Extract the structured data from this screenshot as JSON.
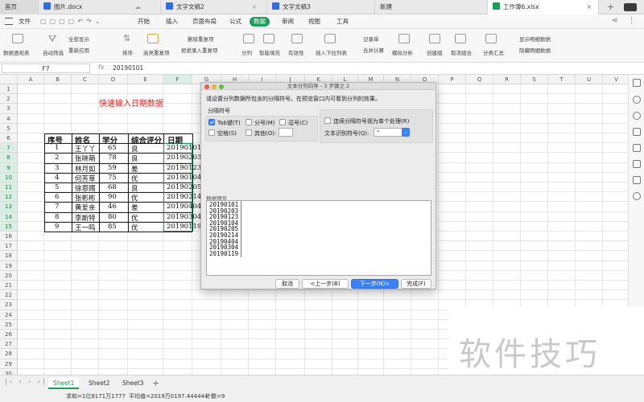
{
  "tabs": [
    {
      "label": "首页",
      "active": false
    },
    {
      "label": "图片.docx",
      "active": false
    },
    {
      "label": "文字文稿2",
      "active": false
    },
    {
      "label": "文字文稿3",
      "active": false
    },
    {
      "label": "新建",
      "active": false
    },
    {
      "label": "工作簿6.xlsx",
      "active": true
    }
  ],
  "menus": [
    "文件",
    "开始",
    "插入",
    "页面布局",
    "公式",
    "数据",
    "审阅",
    "视图",
    "工具"
  ],
  "active_menu": "数据",
  "ribbon": {
    "pivot": "数据透视表",
    "autofilter": "自动筛选",
    "showall": "全部显示",
    "reapply": "重新应用",
    "sort": "排序",
    "highlight_dup": "高亮重复项",
    "remove_dup": "删除重复项",
    "reject_dup": "拒绝录入重复项",
    "split": "分列",
    "smartfill": "智能填充",
    "validity": "有效性",
    "dropdown": "插入下拉列表",
    "record": "记录单",
    "consolidate": "合并计算",
    "whatif": "模拟分析",
    "group": "创建组",
    "ungroup": "取消组合",
    "subtotal": "分类汇总",
    "show_detail": "显示明细数据",
    "hide_detail": "隐藏明细数据"
  },
  "namebox": "F7",
  "formula_value": "20190101",
  "columns": [
    "A",
    "B",
    "C",
    "D",
    "E",
    "F",
    "G",
    "H",
    "I",
    "J",
    "K",
    "L",
    "M",
    "N",
    "O",
    "P",
    "Q",
    "R",
    "S",
    "T",
    "U",
    "V"
  ],
  "rows": [
    "1",
    "2",
    "3",
    "4",
    "5",
    "6",
    "7",
    "8",
    "9",
    "10",
    "11",
    "12",
    "13",
    "14",
    "15",
    "16",
    "17",
    "18",
    "19",
    "20",
    "21",
    "22",
    "23",
    "24",
    "25",
    "26",
    "27",
    "28",
    "29",
    "30"
  ],
  "sheet_title": "快速输入日期数据",
  "table_headers": [
    "序号",
    "姓名",
    "学分",
    "综合评分",
    "日期"
  ],
  "table_rows": [
    [
      "1",
      "王丫丫",
      "65",
      "良",
      "20190101"
    ],
    [
      "2",
      "张晓萌",
      "78",
      "良",
      "20190203"
    ],
    [
      "3",
      "林月如",
      "59",
      "差",
      "20190123"
    ],
    [
      "4",
      "何芳草",
      "75",
      "优",
      "20190104"
    ],
    [
      "5",
      "徐恩赐",
      "68",
      "良",
      "20190205"
    ],
    [
      "6",
      "张彬彬",
      "90",
      "优",
      "20190214"
    ],
    [
      "7",
      "黄爱亲",
      "46",
      "差",
      "20190404"
    ],
    [
      "8",
      "李斯特",
      "80",
      "优",
      "20190304"
    ],
    [
      "9",
      "王一鸣",
      "85",
      "优",
      "20190119"
    ]
  ],
  "dialog": {
    "title": "文本分列向导 - 3 步骤之 2",
    "instruction": "请设置分列数据所包含的分隔符号。在预览窗口内可看到分列的效果。",
    "group_label": "分隔符号",
    "opt_tab": "Tab键(T)",
    "opt_semicolon": "分号(M)",
    "opt_comma": "逗号(C)",
    "opt_space": "空格(S)",
    "opt_other": "其他(O):",
    "opt_consecutive": "连续分隔符号视为单个处理(R)",
    "qualifier_label": "文本识别符号(Q):",
    "qualifier_value": "\"",
    "preview_label": "数据预览",
    "preview_lines": [
      "20190101",
      "20190203",
      "20190123",
      "20190104",
      "20190205",
      "20190214",
      "20190404",
      "20190304",
      "20190119"
    ],
    "btn_cancel": "取消",
    "btn_prev": "<上一步(B)",
    "btn_next": "下一步(N)>",
    "btn_finish": "完成(F)"
  },
  "sheets": [
    {
      "label": "Sheet1",
      "active": true
    },
    {
      "label": "Sheet2",
      "active": false
    },
    {
      "label": "Sheet3",
      "active": false
    }
  ],
  "status": {
    "sum": "求和=1亿8171万1777",
    "avg": "平均值=2019万0197.444444",
    "count": "计数=9"
  },
  "watermark": "软件技巧",
  "colors": {
    "accent": "#1f9c5a",
    "title_red": "#e02020",
    "dialog_blue": "#3b82f6"
  }
}
